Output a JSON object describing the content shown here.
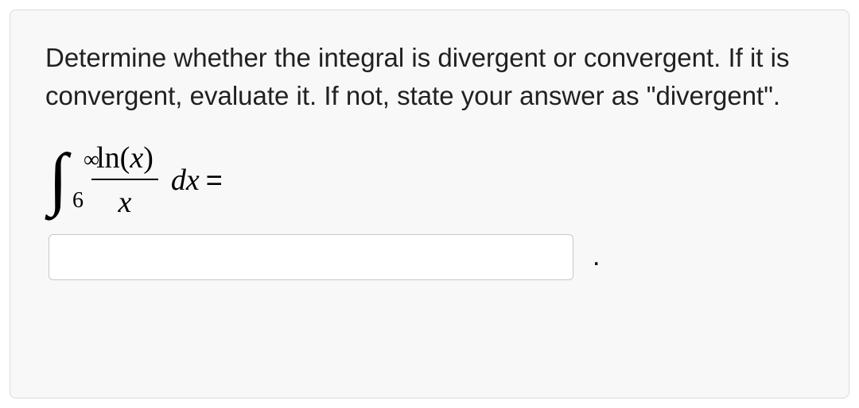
{
  "question": {
    "prompt": "Determine whether the integral is divergent or convergent. If it is convergent, evaluate it. If not, state your answer as \"divergent\"."
  },
  "integral": {
    "upper_limit": "∞",
    "lower_limit": "6",
    "numerator": "ln(x)",
    "denominator": "x",
    "differential": "dx",
    "equals": "="
  },
  "answer": {
    "value": "",
    "placeholder": ""
  },
  "trailing_period": "."
}
